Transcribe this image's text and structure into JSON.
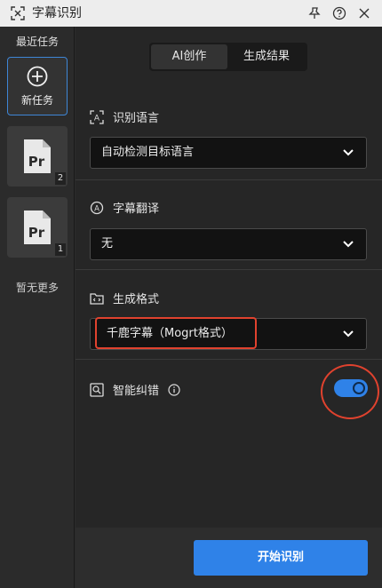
{
  "window": {
    "title": "字幕识别",
    "icons": {
      "app": "caption-scan-icon",
      "pin": "pin-icon",
      "help": "help-icon",
      "close": "close-icon"
    }
  },
  "sidebar": {
    "title": "最近任务",
    "new_task_label": "新任务",
    "tasks": [
      {
        "icon": "premiere-file-icon",
        "file_type": "Pr",
        "badge": "2"
      },
      {
        "icon": "premiere-file-icon",
        "file_type": "Pr",
        "badge": "1"
      }
    ],
    "no_more": "暂无更多"
  },
  "tabs": [
    {
      "label": "AI创作",
      "active": true
    },
    {
      "label": "生成结果",
      "active": false
    }
  ],
  "sections": {
    "language": {
      "label": "识别语言",
      "value": "自动检测目标语言"
    },
    "translation": {
      "label": "字幕翻译",
      "value": "无"
    },
    "format": {
      "label": "生成格式",
      "value": "千鹿字幕（Mogrt格式）"
    },
    "smart_correction": {
      "label": "智能纠错",
      "enabled": true
    }
  },
  "footer": {
    "start_label": "开始识别"
  },
  "colors": {
    "accent": "#2f82e8",
    "annotation": "#e0422e",
    "background": "#262626"
  }
}
